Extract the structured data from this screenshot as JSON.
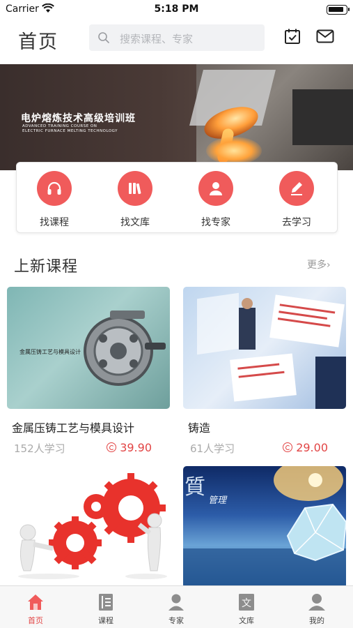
{
  "status_bar": {
    "carrier": "Carrier",
    "time": "5:18 PM",
    "battery_level": 0.9
  },
  "header": {
    "title": "首页",
    "search_placeholder": "搜索课程、专家",
    "icons": [
      "search-icon",
      "calendar-check-icon",
      "mail-icon"
    ]
  },
  "banner": {
    "title": "电炉熔炼技术高级培训班",
    "subtitle_line1": "ADVANCED TRAINING COURSE ON",
    "subtitle_line2": "ELECTRIC FURNACE MELTING TECHNOLOGY"
  },
  "quick_nav": [
    {
      "label": "找课程",
      "icon": "headphones-icon"
    },
    {
      "label": "找文库",
      "icon": "books-icon"
    },
    {
      "label": "找专家",
      "icon": "person-icon"
    },
    {
      "label": "去学习",
      "icon": "pencil-icon"
    }
  ],
  "section": {
    "title": "上新课程",
    "more": "更多›"
  },
  "courses": [
    {
      "name": "金属压铸工艺与模具设计",
      "learners": "152人学习",
      "price": "39.90",
      "thumb_text": "金属压铸工艺与模具设计"
    },
    {
      "name": "铸造",
      "learners": "61人学习",
      "price": "29.00"
    },
    {
      "name": "",
      "learners": "",
      "price": ""
    },
    {
      "name": "",
      "learners": "",
      "price": "",
      "thumb_text": "管理"
    }
  ],
  "tabs": [
    {
      "label": "首页",
      "icon": "home-icon",
      "active": true
    },
    {
      "label": "课程",
      "icon": "course-icon",
      "active": false
    },
    {
      "label": "专家",
      "icon": "expert-icon",
      "active": false
    },
    {
      "label": "文库",
      "icon": "library-icon",
      "active": false
    },
    {
      "label": "我的",
      "icon": "profile-icon",
      "active": false
    }
  ],
  "colors": {
    "accent": "#f05b5b",
    "price": "#e24545",
    "active_tab": "#e24545"
  }
}
